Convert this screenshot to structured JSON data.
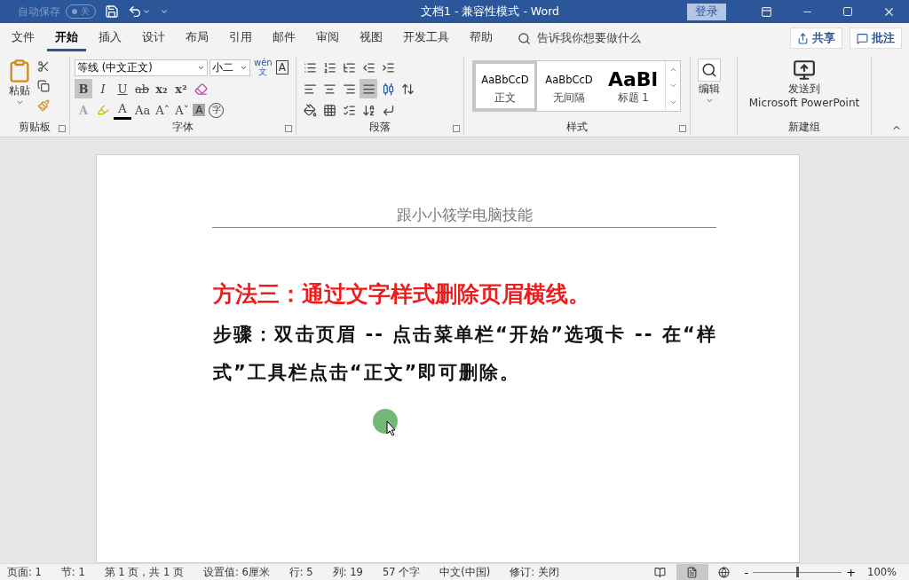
{
  "title_bar": {
    "autosave_label": "自动保存",
    "autosave_toggle": {
      "on": false,
      "label": "关"
    },
    "title": "文档1  -  兼容性模式  -  Word",
    "login": "登录"
  },
  "tabs": [
    {
      "label": "文件",
      "selected": false
    },
    {
      "label": "开始",
      "selected": true
    },
    {
      "label": "插入",
      "selected": false
    },
    {
      "label": "设计",
      "selected": false
    },
    {
      "label": "布局",
      "selected": false
    },
    {
      "label": "引用",
      "selected": false
    },
    {
      "label": "邮件",
      "selected": false
    },
    {
      "label": "审阅",
      "selected": false
    },
    {
      "label": "视图",
      "selected": false
    },
    {
      "label": "开发工具",
      "selected": false
    },
    {
      "label": "帮助",
      "selected": false
    }
  ],
  "tell_me": {
    "placeholder": "告诉我你想要做什么"
  },
  "share": "共享",
  "comment": "批注",
  "clipboard": {
    "paste": "粘贴",
    "label": "剪贴板"
  },
  "font": {
    "label": "字体",
    "font_name": "等线 (中文正文)",
    "font_size": "小二",
    "phonetic_top": "wén",
    "phonetic_bottom": "文",
    "border_char": "A",
    "buttons": [
      {
        "label": "B",
        "kind": "bold",
        "selected": true
      },
      {
        "label": "I",
        "kind": "italic",
        "selected": false
      },
      {
        "label": "U",
        "kind": "underline",
        "selected": false
      },
      {
        "label": "ab",
        "kind": "strike",
        "selected": false
      },
      {
        "label": "x₂",
        "kind": "sub",
        "selected": false
      },
      {
        "label": "x²",
        "kind": "sup",
        "selected": false
      }
    ],
    "effects": "A",
    "font_color": "A",
    "case": "Aa",
    "grow": "Aˆ",
    "shrink": "Aˇ",
    "shading": "A",
    "enclose": "字"
  },
  "paragraph": {
    "label": "段落",
    "alignments": [
      {
        "kind": "left",
        "selected": false
      },
      {
        "kind": "center",
        "selected": false
      },
      {
        "kind": "right",
        "selected": false
      },
      {
        "kind": "justify",
        "selected": true
      },
      {
        "kind": "distributed",
        "selected": false
      }
    ]
  },
  "styles": {
    "label": "样式",
    "items": [
      {
        "preview": "AaBbCcD",
        "name": "正文",
        "kind": "normal",
        "selected": true
      },
      {
        "preview": "AaBbCcD",
        "name": "无间隔",
        "kind": "normal",
        "selected": false
      },
      {
        "preview": "AaBl",
        "name": "标题 1",
        "kind": "heading",
        "selected": false
      }
    ]
  },
  "editing": {
    "label": "编辑"
  },
  "send": {
    "line1": "发送到",
    "line2": "Microsoft PowerPoint",
    "group": "新建组"
  },
  "document": {
    "header": "跟小小筱学电脑技能",
    "heading": "方法三：通过文字样式删除页眉横线。",
    "body": "步骤：双击页眉 -- 点击菜单栏“开始”选项卡 -- 在“样式”工具栏点击“正文”即可删除。"
  },
  "status_bar": {
    "items": [
      "页面: 1",
      "节: 1",
      "第 1 页，共 1 页",
      "设置值: 6厘米",
      "行: 5",
      "列: 19",
      "57 个字",
      "中文(中国)",
      "修订: 关闭"
    ],
    "views": [
      {
        "kind": "read",
        "selected": false
      },
      {
        "kind": "print",
        "selected": true
      },
      {
        "kind": "web",
        "selected": false
      }
    ],
    "zoom": {
      "minus": "-",
      "plus": "+",
      "level": 0.5,
      "value": "100%"
    }
  }
}
